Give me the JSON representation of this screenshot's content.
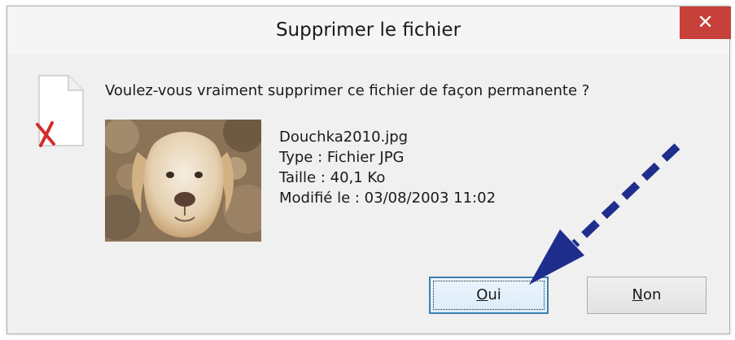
{
  "window": {
    "title": "Supprimer le fichier",
    "close_glyph": "✕"
  },
  "dialog": {
    "question": "Voulez-vous vraiment supprimer ce fichier de façon permanente ?",
    "icon": "file-delete-icon",
    "thumbnail": "dog-photo-thumbnail"
  },
  "file": {
    "name": "Douchka2010.jpg",
    "type": "Type : Fichier JPG",
    "size": "Taille : 40,1 Ko",
    "modified": "Modifié le : 03/08/2003 11:02"
  },
  "buttons": {
    "yes_mnemonic": "O",
    "yes_rest": "ui",
    "no_mnemonic": "N",
    "no_rest": "on"
  },
  "colors": {
    "close_bg": "#c7413a",
    "arrow": "#1f2e8c",
    "focus_border": "#3c7fb1"
  }
}
